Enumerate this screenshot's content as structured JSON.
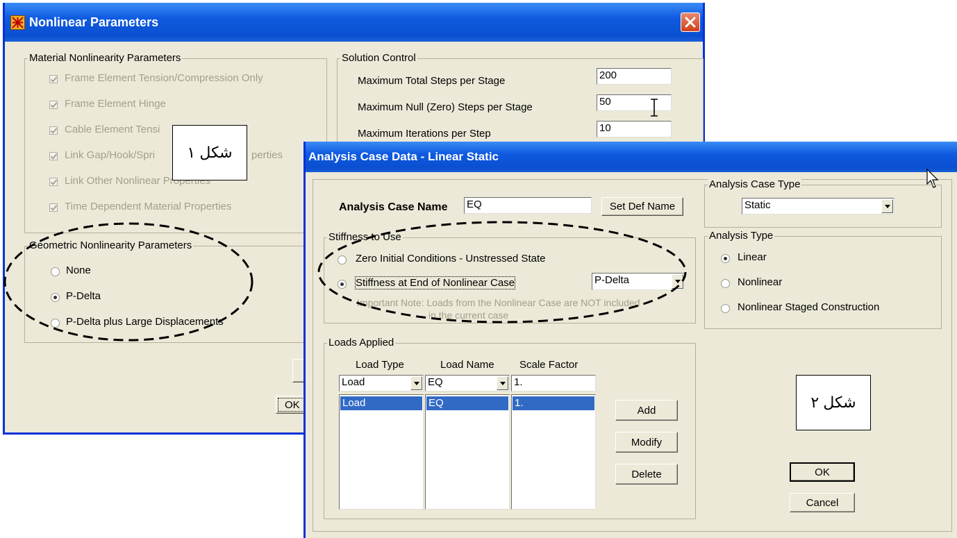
{
  "window1": {
    "title": "Nonlinear Parameters",
    "material": {
      "legend": "Material Nonlinearity Parameters",
      "items": [
        "Frame Element Tension/Compression Only",
        "Frame Element Hinge",
        "Cable Element Tensi",
        "Link Gap/Hook/Spri",
        "Link Other Nonlinear Properties",
        "Time Dependent Material Properties"
      ],
      "link_suffix": "perties"
    },
    "geometric": {
      "legend": "Geometric Nonlinearity Parameters",
      "options": [
        "None",
        "P-Delta",
        "P-Delta plus Large Displacements"
      ],
      "selected": "P-Delta"
    },
    "solution": {
      "legend": "Solution Control",
      "rows": [
        {
          "label": "Maximum Total Steps per Stage",
          "value": "200"
        },
        {
          "label": "Maximum Null (Zero) Steps per Stage",
          "value": "50"
        },
        {
          "label": "Maximum Iterations per Step",
          "value": "10"
        }
      ]
    },
    "ok_partial": "OK"
  },
  "window2": {
    "title": "Analysis Case Data - Linear Static",
    "case_name_label": "Analysis Case Name",
    "case_name_value": "EQ",
    "set_def_name": "Set Def Name",
    "case_type": {
      "legend": "Analysis Case Type",
      "value": "Static"
    },
    "analysis_type": {
      "legend": "Analysis Type",
      "options": [
        "Linear",
        "Nonlinear",
        "Nonlinear Staged Construction"
      ],
      "selected": "Linear"
    },
    "stiffness": {
      "legend": "Stiffness to Use",
      "opt1": "Zero Initial Conditions - Unstressed State",
      "opt2": "Stiffness at End of Nonlinear Case",
      "case": "P-Delta",
      "note1": "Important Note:  Loads from the Nonlinear Case are NOT included",
      "note2": "in the current case"
    },
    "loads": {
      "legend": "Loads Applied",
      "headers": [
        "Load Type",
        "Load Name",
        "Scale Factor"
      ],
      "input": {
        "type": "Load",
        "name": "EQ",
        "factor": "1."
      },
      "rows": [
        {
          "type": "Load",
          "name": "EQ",
          "factor": "1."
        }
      ],
      "add": "Add",
      "modify": "Modify",
      "delete": "Delete"
    },
    "ok": "OK",
    "cancel": "Cancel"
  },
  "annotations": {
    "fig1": "شکل ۱",
    "fig2": "شکل ۲"
  }
}
